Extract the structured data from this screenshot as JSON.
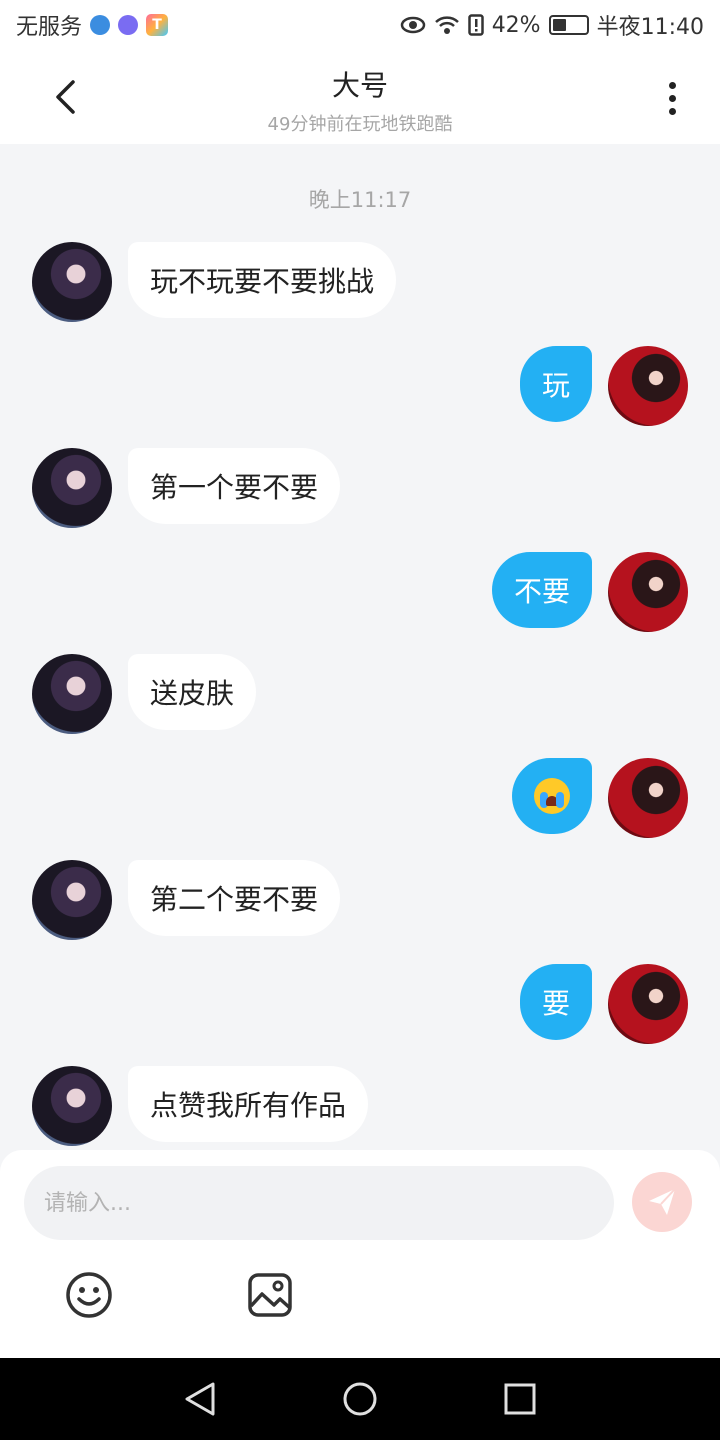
{
  "status_bar": {
    "carrier": "无服务",
    "battery": "42%",
    "battery_level": 0.42,
    "time": "半夜11:40",
    "icons": [
      "browser-icon",
      "music-icon",
      "app-store-icon",
      "eye-icon",
      "wifi-icon",
      "sim-alert-icon",
      "battery-icon"
    ]
  },
  "header": {
    "title": "大号",
    "subtitle": "49分钟前在玩地铁跑酷",
    "back_icon": "chevron-left-icon",
    "menu_icon": "more-vertical-icon"
  },
  "chat": {
    "timestamp": "晚上11:17",
    "messages": [
      {
        "from": "them",
        "text": "玩不玩要不要挑战"
      },
      {
        "from": "me",
        "text": "玩"
      },
      {
        "from": "them",
        "text": "第一个要不要"
      },
      {
        "from": "me",
        "text": "不要"
      },
      {
        "from": "them",
        "text": "送皮肤"
      },
      {
        "from": "me",
        "text": "",
        "emoji": "loudly-crying-face-emoji"
      },
      {
        "from": "them",
        "text": "第二个要不要"
      },
      {
        "from": "me",
        "text": "要"
      },
      {
        "from": "them",
        "text": "点赞我所有作品"
      }
    ]
  },
  "composer": {
    "placeholder": "请输入...",
    "value": "",
    "send_icon": "send-plane-icon",
    "emoji_icon": "smiley-icon",
    "image_icon": "image-icon"
  },
  "nav": {
    "back_icon": "triangle-back-icon",
    "home_icon": "circle-home-icon",
    "recents_icon": "square-recents-icon"
  },
  "colors": {
    "my_bubble": "#23b0f3",
    "their_bubble": "#ffffff",
    "background": "#f4f5f7",
    "send_button": "#fbd6d3"
  }
}
